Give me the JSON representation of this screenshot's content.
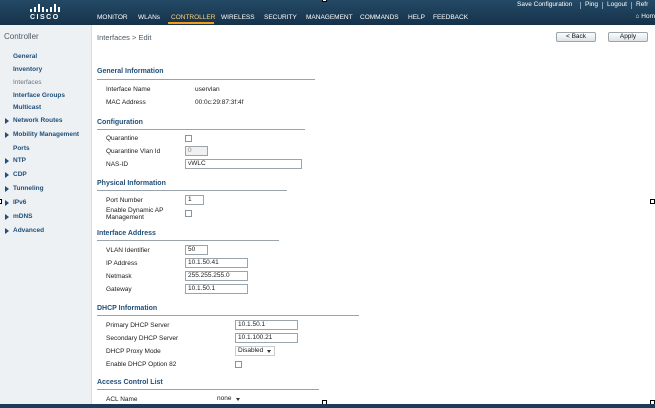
{
  "header": {
    "brand": "CISCO",
    "util_links": [
      "Save Configuration",
      "Ping",
      "Logout",
      "Refr"
    ],
    "menu": [
      "MONITOR",
      "WLANs",
      "CONTROLLER",
      "WIRELESS",
      "SECURITY",
      "MANAGEMENT",
      "COMMANDS",
      "HELP",
      "FEEDBACK"
    ],
    "active_menu": "CONTROLLER",
    "home": "Hom"
  },
  "sidebar": {
    "title": "Controller",
    "items": [
      {
        "label": "General",
        "expandable": false
      },
      {
        "label": "Inventory",
        "expandable": false
      },
      {
        "label": "Interfaces",
        "expandable": false,
        "current": true
      },
      {
        "label": "Interface Groups",
        "expandable": false
      },
      {
        "label": "Multicast",
        "expandable": false
      },
      {
        "label": "Network Routes",
        "expandable": true
      },
      {
        "label": "Mobility Management",
        "expandable": true
      },
      {
        "label": "Ports",
        "expandable": false
      },
      {
        "label": "NTP",
        "expandable": true
      },
      {
        "label": "CDP",
        "expandable": true
      },
      {
        "label": "Tunneling",
        "expandable": true
      },
      {
        "label": "IPv6",
        "expandable": true
      },
      {
        "label": "mDNS",
        "expandable": true
      },
      {
        "label": "Advanced",
        "expandable": true
      }
    ]
  },
  "page": {
    "breadcrumb": "Interfaces > Edit",
    "back_label": "< Back",
    "apply_label": "Apply"
  },
  "general": {
    "title": "General Information",
    "interface_name_label": "Interface Name",
    "interface_name": "uservlan",
    "mac_label": "MAC Address",
    "mac": "00:0c:29:87:3f:4f"
  },
  "configuration": {
    "title": "Configuration",
    "quarantine_label": "Quarantine",
    "quarantine_vlan_label": "Quarantine Vlan Id",
    "quarantine_vlan": "0",
    "nas_id_label": "NAS-ID",
    "nas_id": "vWLC"
  },
  "physical": {
    "title": "Physical Information",
    "port_label": "Port Number",
    "port": "1",
    "dyn_ap_label_1": "Enable Dynamic AP",
    "dyn_ap_label_2": "Management"
  },
  "address": {
    "title": "Interface Address",
    "vlan_label": "VLAN Identifier",
    "vlan": "50",
    "ip_label": "IP Address",
    "ip": "10.1.50.41",
    "netmask_label": "Netmask",
    "netmask": "255.255.255.0",
    "gateway_label": "Gateway",
    "gateway": "10.1.50.1"
  },
  "dhcp": {
    "title": "DHCP Information",
    "primary_label": "Primary DHCP Server",
    "primary": "10.1.50.1",
    "secondary_label": "Secondary DHCP Server",
    "secondary": "10.1.100.21",
    "proxy_label": "DHCP Proxy Mode",
    "proxy": "Disabled",
    "opt82_label": "Enable DHCP Option 82"
  },
  "acl": {
    "title": "Access Control List",
    "acl_label": "ACL Name",
    "acl_value": "none"
  }
}
